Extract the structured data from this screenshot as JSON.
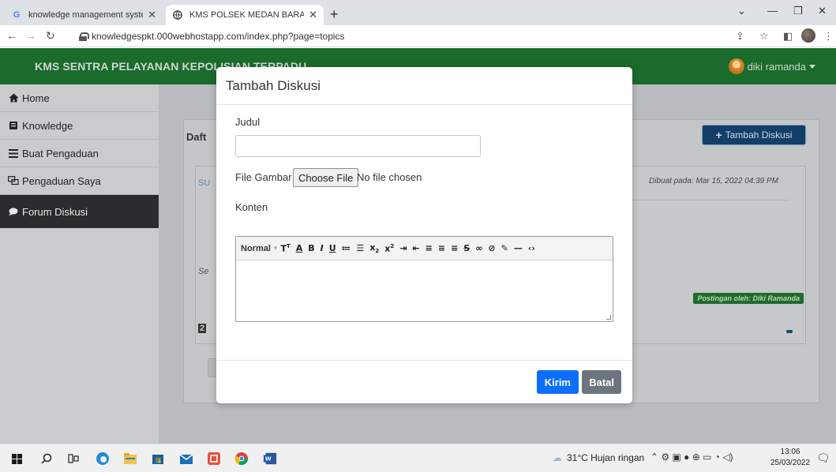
{
  "browser": {
    "tabs": [
      {
        "title": "knowledge management system",
        "icon": "G"
      },
      {
        "title": "KMS POLSEK MEDAN BARAT",
        "icon": "globe"
      }
    ],
    "url": "knowledgespkt.000webhostapp.com/index.php?page=topics"
  },
  "app": {
    "brand": "KMS SENTRA PELAYANAN KEPOLISIAN TERPADU",
    "user": "diki ramanda",
    "sidebar": [
      {
        "label": "Home",
        "icon": "home-icon"
      },
      {
        "label": "Knowledge",
        "icon": "book-icon"
      },
      {
        "label": "Buat Pengaduan",
        "icon": "bars-icon"
      },
      {
        "label": "Pengaduan Saya",
        "icon": "chat-icon"
      },
      {
        "label": "Forum Diskusi",
        "icon": "comment-icon"
      }
    ],
    "card": {
      "title_fragment": "Daft",
      "add_button": "Tambah Diskusi",
      "posted_date": "Dibuat pada: Mar 15, 2022 04:39 PM",
      "posted_by": "Postingan oleh: Diki Ramanda",
      "fragment_su": "SU",
      "fragment_se": "Se",
      "fragment_2": "2"
    }
  },
  "modal": {
    "title": "Tambah Diskusi",
    "judul_label": "Judul",
    "judul_value": "",
    "file_label": "File Gambar",
    "file_button": "Choose File",
    "file_status": "No file chosen",
    "konten_label": "Konten",
    "editor_format": "Normal",
    "submit": "Kirim",
    "cancel": "Batal"
  },
  "taskbar": {
    "weather": "31°C  Hujan ringan",
    "time": "13:06",
    "date": "25/03/2022"
  }
}
